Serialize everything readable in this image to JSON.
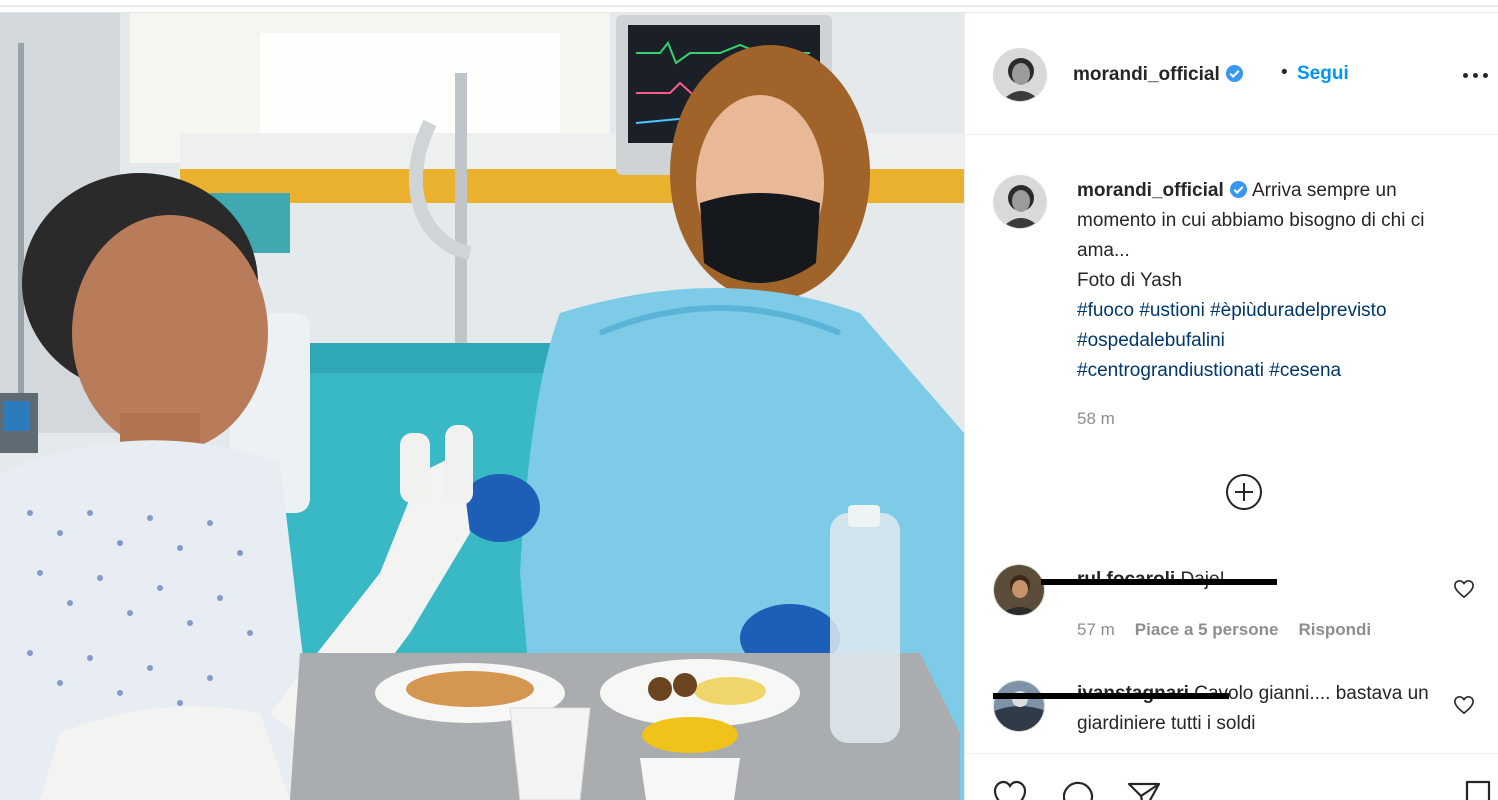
{
  "post": {
    "username": "morandi_official",
    "separator": "•",
    "follow_label": "Segui",
    "caption_text": "Arriva sempre un momento in cui abbiamo bisogno di chi ci ama...",
    "caption_credit": "Foto di Yash",
    "hashtags": [
      "#fuoco",
      "#ustioni",
      "#èpiùduradelprevisto",
      "#ospedalebufalini",
      "#centrograndiustionati",
      "#cesena"
    ],
    "time": "58 m"
  },
  "comments": [
    {
      "username": "rul.focaroli",
      "text": "Daje!",
      "time": "57 m",
      "likes": "Piace a 5 persone",
      "reply_label": "Rispondi"
    },
    {
      "username": "ivanstagnari",
      "text": "Cavolo gianni.... bastava un giardiniere tutti i soldi"
    }
  ],
  "icons": {
    "verified": "verified-badge-icon",
    "more": "more-options-icon",
    "plus": "load-more-comments-icon",
    "heart": "like-heart-icon",
    "comment": "comment-bubble-icon",
    "share": "share-paper-plane-icon",
    "save": "bookmark-icon"
  },
  "colors": {
    "accent": "#0095f6",
    "hashtag": "#00376b",
    "muted": "#8e8e8e",
    "text": "#262626",
    "verified": "#3897f0"
  }
}
